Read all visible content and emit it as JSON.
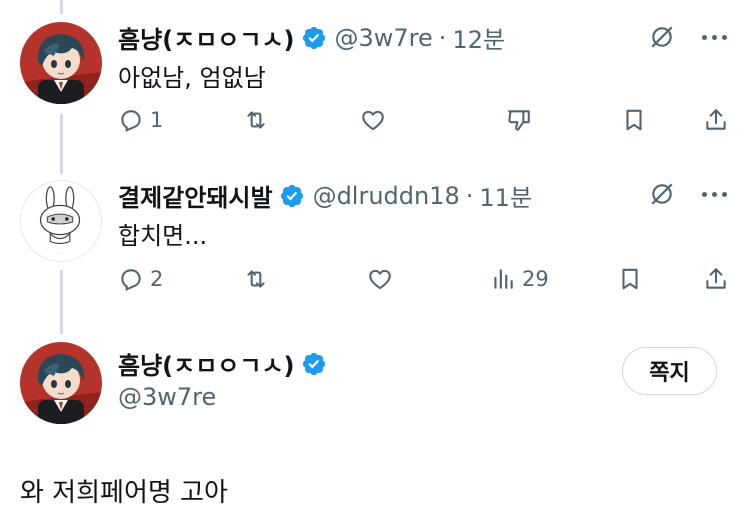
{
  "reply1": {
    "name": "흠냥(ㅈㅁㅇㄱㅅ)",
    "handle": "@3w7re",
    "separator": "·",
    "time": "12분",
    "text": "아없남, 엄없남",
    "replies": "1"
  },
  "reply2": {
    "name": "결제같안돼시발",
    "handle": "@dlruddn18",
    "separator": "·",
    "time": "11분",
    "text": "합치면...",
    "replies": "2",
    "views": "29"
  },
  "main": {
    "name": "흠냥(ㅈㅁㅇㄱㅅ)",
    "handle": "@3w7re",
    "dm_label": "쪽지",
    "text": "와 저희페어명 고아"
  },
  "colors": {
    "verified": "#1d9bf0",
    "secondary_text": "#536471",
    "thread_line": "#cfd9de"
  },
  "icons": {
    "grok": "grok-icon",
    "more": "more-icon",
    "reply": "reply-icon",
    "repost": "repost-icon",
    "like": "heart-icon",
    "dislike": "downvote-icon",
    "views": "views-icon",
    "bookmark": "bookmark-icon",
    "share": "share-icon"
  }
}
